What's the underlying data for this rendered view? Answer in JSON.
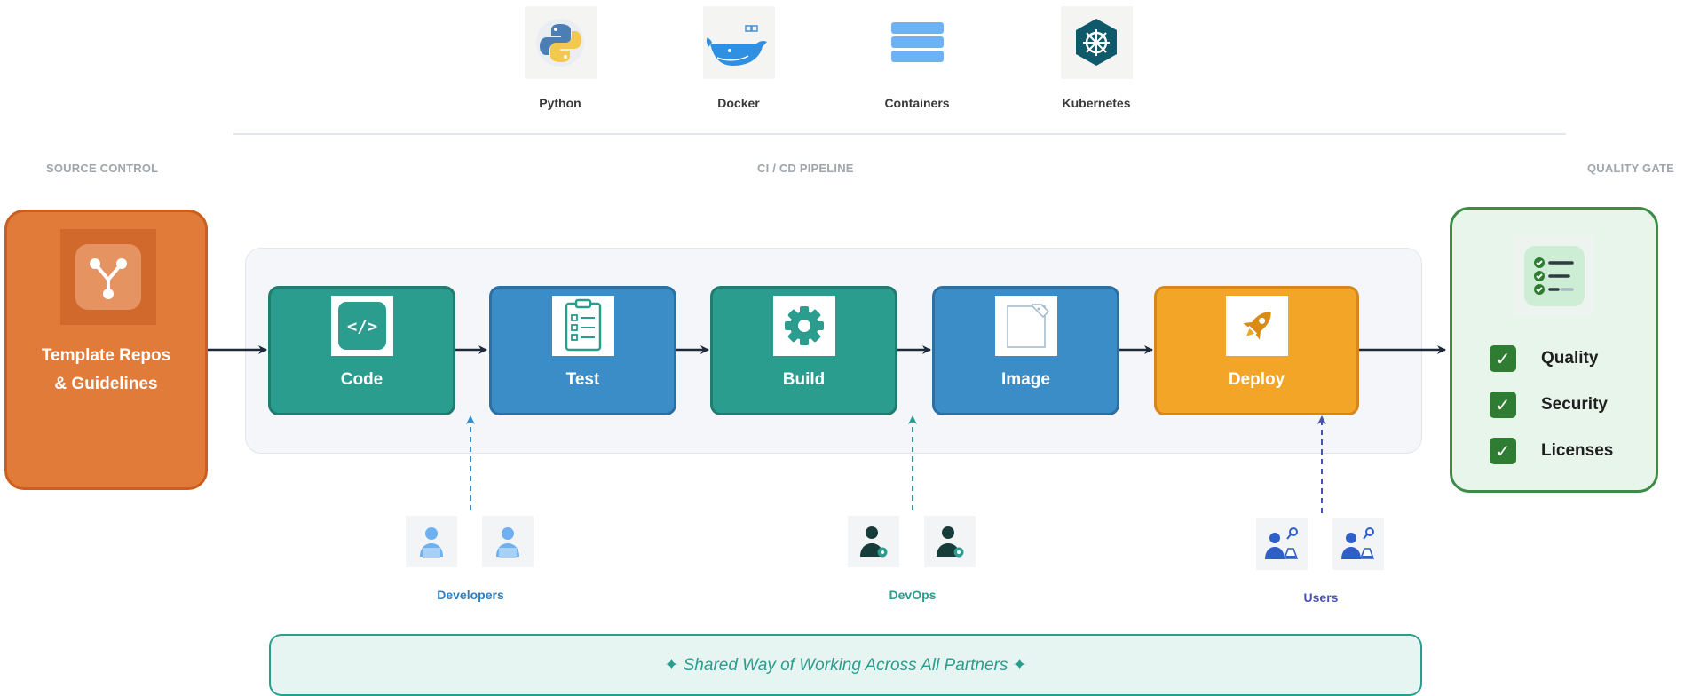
{
  "tech_stack": [
    {
      "label": "Python",
      "icon": "python-icon"
    },
    {
      "label": "Docker",
      "icon": "docker-icon"
    },
    {
      "label": "Containers",
      "icon": "containers-icon"
    },
    {
      "label": "Kubernetes",
      "icon": "kubernetes-icon"
    }
  ],
  "sections": {
    "source_control": "SOURCE CONTROL",
    "pipeline": "CI / CD PIPELINE",
    "quality_gate": "QUALITY GATE"
  },
  "source": {
    "line1": "Template Repos",
    "line2": "& Guidelines",
    "icon": "branch-icon",
    "color": "#e07b3a"
  },
  "stages": [
    {
      "label": "Code",
      "icon": "code-icon",
      "color": "#2a9d8e"
    },
    {
      "label": "Test",
      "icon": "clipboard-icon",
      "color": "#3b8dc8"
    },
    {
      "label": "Build",
      "icon": "gear-icon",
      "color": "#2a9d8e"
    },
    {
      "label": "Image",
      "icon": "image-icon",
      "color": "#3b8dc8"
    },
    {
      "label": "Deploy",
      "icon": "rocket-icon",
      "color": "#f2a526"
    }
  ],
  "quality_checks": [
    {
      "label": "Quality"
    },
    {
      "label": "Security"
    },
    {
      "label": "Licenses"
    }
  ],
  "groups": [
    {
      "label": "Developers",
      "icon": "developer-icon",
      "color": "#2f7fc0"
    },
    {
      "label": "DevOps",
      "icon": "devops-icon",
      "color": "#2a9d8e"
    },
    {
      "label": "Users",
      "icon": "user-research-icon",
      "color": "#4a52b0"
    }
  ],
  "banner": {
    "text": "✦ Shared Way of Working Across All Partners ✦"
  }
}
